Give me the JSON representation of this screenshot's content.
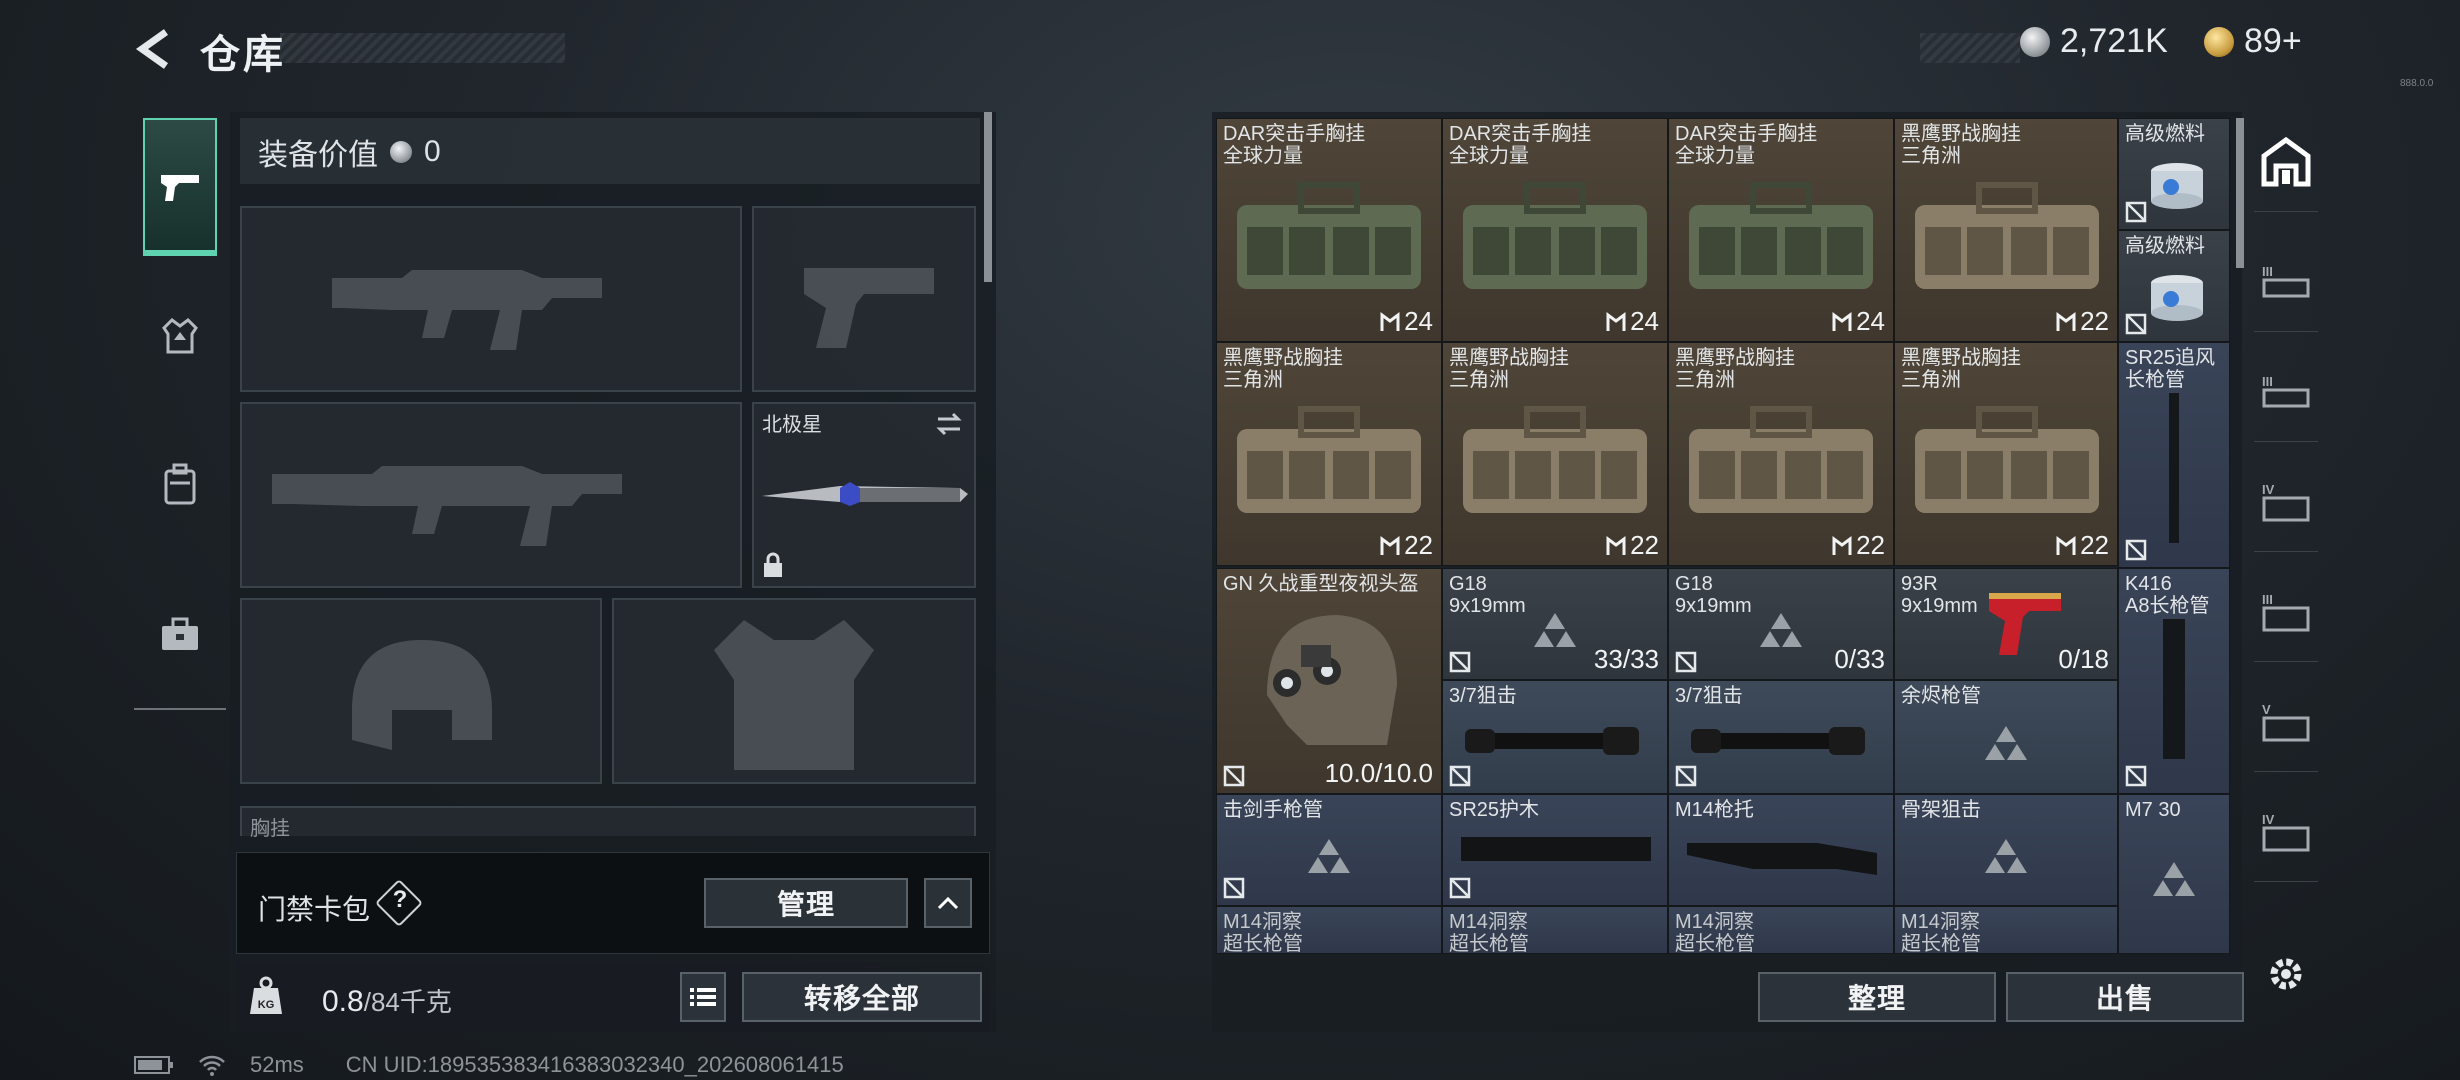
{
  "header": {
    "title": "仓库",
    "currency_silver": "2,721K",
    "currency_gold": "89+",
    "version": "888.0.0"
  },
  "left_tabs": [
    {
      "name": "weapon-tab",
      "icon": "pistol-icon",
      "active": true
    },
    {
      "name": "armor-tab",
      "icon": "vest-icon",
      "active": false
    },
    {
      "name": "backpack-tab",
      "icon": "backpack-icon",
      "active": false
    },
    {
      "name": "case-tab",
      "icon": "briefcase-icon",
      "active": false
    }
  ],
  "loadout": {
    "value_label": "装备价值",
    "value": "0",
    "melee_name": "北极星",
    "chest_rig_label": "胸挂",
    "keycard_label": "门禁卡包",
    "help": "?",
    "manage": "管理"
  },
  "weight": {
    "current": "0.8",
    "max_unit": "/84千克",
    "transfer_all": "转移全部"
  },
  "status": {
    "ping": "52ms",
    "uid": "CN UID:18953538341638303234​0_202608061415"
  },
  "grid": {
    "sort": "整理",
    "sell": "出售",
    "items": [
      {
        "name1": "DAR突击手胸挂",
        "name2": "全球力量",
        "count": "24",
        "kind": "bag-green"
      },
      {
        "name1": "DAR突击手胸挂",
        "name2": "全球力量",
        "count": "24",
        "kind": "bag-green"
      },
      {
        "name1": "DAR突击手胸挂",
        "name2": "全球力量",
        "count": "24",
        "kind": "bag-green"
      },
      {
        "name1": "黑鹰野战胸挂",
        "name2": "三角洲",
        "count": "22",
        "kind": "bag-tan"
      },
      {
        "name1": "黑鹰野战胸挂",
        "name2": "三角洲",
        "count": "22",
        "kind": "bag-tan"
      },
      {
        "name1": "黑鹰野战胸挂",
        "name2": "三角洲",
        "count": "22",
        "kind": "bag-tan"
      },
      {
        "name1": "黑鹰野战胸挂",
        "name2": "三角洲",
        "count": "22",
        "kind": "bag-tan"
      },
      {
        "name1": "黑鹰野战胸挂",
        "name2": "三角洲",
        "count": "22",
        "kind": "bag-tan"
      }
    ],
    "fuel": "高级燃料",
    "sr25_barrel": [
      "SR25追风",
      "长枪管"
    ],
    "helmet": {
      "name": "GN 久战重型夜视头盔",
      "durability": "10.0/10.0"
    },
    "g18a": {
      "name1": "G18",
      "name2": "9x19mm",
      "ammo": "33/33"
    },
    "g18b": {
      "name1": "G18",
      "name2": "9x19mm",
      "ammo": "0/33"
    },
    "r93": {
      "name1": "93R",
      "name2": "9x19mm",
      "ammo": "0/18"
    },
    "k416": [
      "K416",
      "A8长枪管"
    ],
    "scope1": "3/7狙击",
    "scope2": "3/7狙击",
    "ember": "余烬枪管",
    "sword": "击剑手枪管",
    "sr25_guard": "SR25护木",
    "m14_stock": "M14枪托",
    "bone": "骨架狙击",
    "m7": "M7 30",
    "m14a": [
      "M14洞察",
      "超长枪管"
    ],
    "m14b": [
      "M14洞察",
      "超长枪管"
    ],
    "m14c": [
      "M14洞察",
      "超长枪管"
    ],
    "m14d": [
      "M14洞察",
      "超长枪管"
    ]
  }
}
